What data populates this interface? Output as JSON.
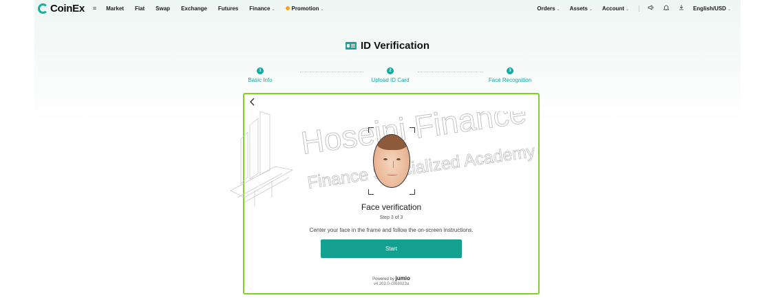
{
  "nav": {
    "logo_text": "CoinEx",
    "menu_icon": "≡",
    "items": [
      "Market",
      "Fiat",
      "Swap",
      "Exchange",
      "Futures",
      "Finance",
      "Promotion"
    ],
    "right_items": [
      "Orders",
      "Assets",
      "Account"
    ],
    "language": "English/USD"
  },
  "page": {
    "title": "ID Verification"
  },
  "steps": [
    {
      "num": "1",
      "label": "Basic Info"
    },
    {
      "num": "2",
      "label": "Upload ID Card"
    },
    {
      "num": "3",
      "label": "Face Recognition"
    }
  ],
  "card": {
    "back_icon": "‹",
    "title": "Face verification",
    "step_text": "Step 3 of 3",
    "instruction": "Center your face in the frame and follow the on-screen instructions.",
    "start_label": "Start",
    "powered_by": "Powered by",
    "brand": "jumio",
    "version": "v4.203.0-c068023a"
  },
  "watermark": {
    "line1": "Hoseini Finance",
    "line2": "Finance Specialized Academy"
  },
  "colors": {
    "accent": "#13a89e",
    "highlight_border": "#7ed321",
    "button": "#13a08f"
  }
}
